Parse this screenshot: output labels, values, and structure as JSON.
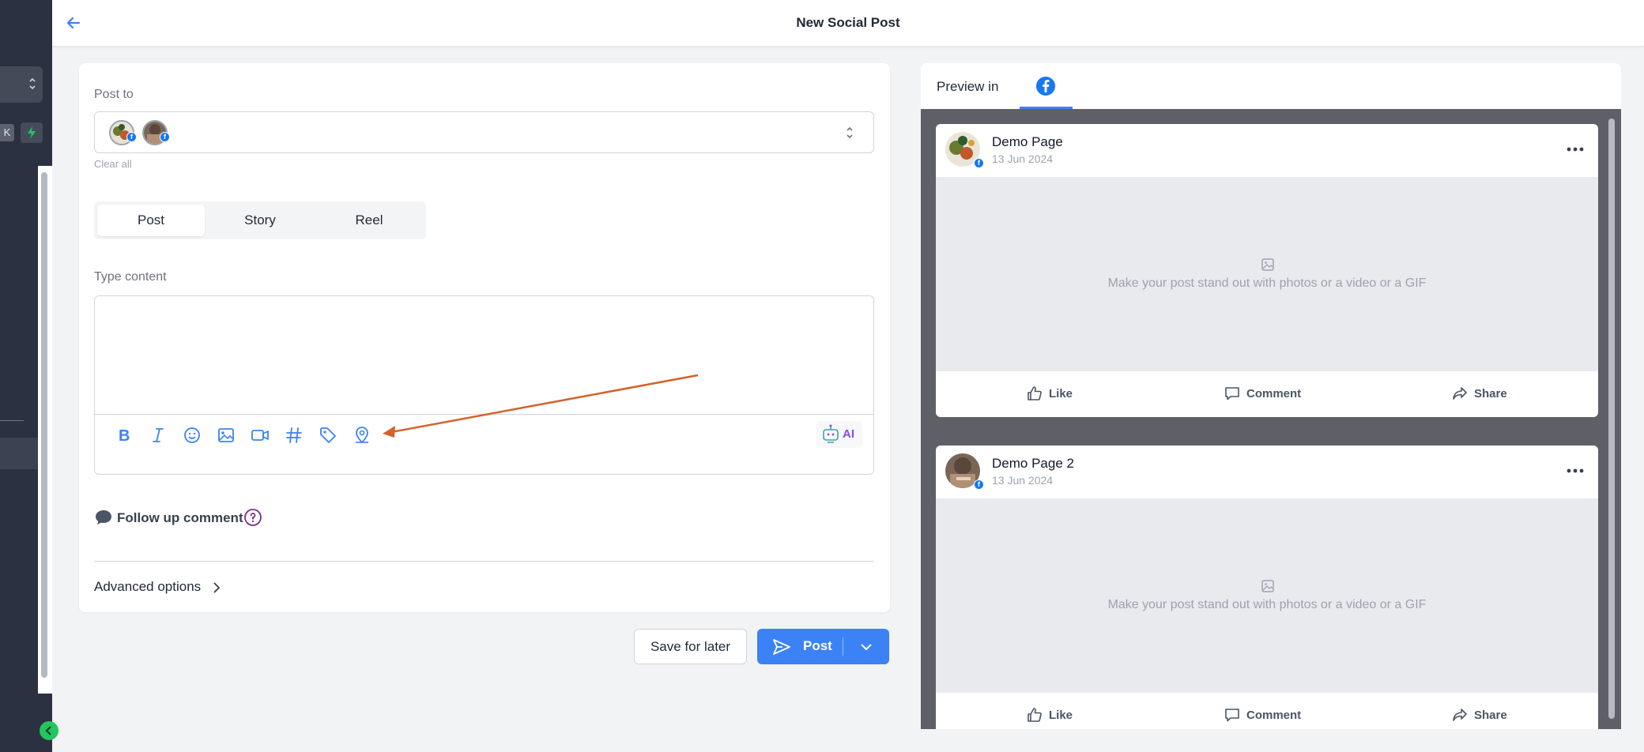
{
  "header": {
    "title": "New Social Post"
  },
  "sidebar": {
    "kbd": "K"
  },
  "composer": {
    "post_to_label": "Post to",
    "clear_all": "Clear all",
    "tabs": [
      "Post",
      "Story",
      "Reel"
    ],
    "active_tab": "Post",
    "content_label": "Type content",
    "ai_label": "AI",
    "follow_up_label": "Follow up comment",
    "advanced_label": "Advanced options"
  },
  "actions": {
    "save_label": "Save for later",
    "post_label": "Post"
  },
  "preview": {
    "label": "Preview in",
    "cards": [
      {
        "page": "Demo Page",
        "date": "13 Jun 2024",
        "placeholder": "Make your post stand out with photos or a video or a GIF"
      },
      {
        "page": "Demo Page 2",
        "date": "13 Jun 2024",
        "placeholder": "Make your post stand out with photos or a video or a GIF"
      }
    ],
    "actions": {
      "like": "Like",
      "comment": "Comment",
      "share": "Share"
    }
  },
  "colors": {
    "accent": "#3b82f6",
    "facebook": "#1877f2",
    "annotation_arrow": "#d4622a",
    "ai": "#7c4dff"
  }
}
